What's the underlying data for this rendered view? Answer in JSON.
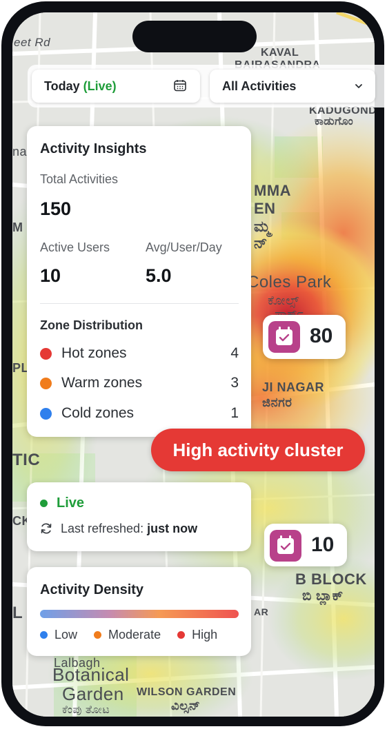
{
  "filters": {
    "date_label": "Today",
    "date_live": "(Live)",
    "activity_select": "All Activities"
  },
  "insights": {
    "title": "Activity Insights",
    "total_label": "Total Activities",
    "total_value": "150",
    "active_users_label": "Active Users",
    "active_users_value": "10",
    "avg_label": "Avg/User/Day",
    "avg_value": "5.0",
    "zone_title": "Zone Distribution",
    "zones": [
      {
        "label": "Hot zones",
        "count": "4",
        "color": "#e53935"
      },
      {
        "label": "Warm zones",
        "count": "3",
        "color": "#f07c1c"
      },
      {
        "label": "Cold zones",
        "count": "1",
        "color": "#2f80ed"
      }
    ]
  },
  "markers": [
    {
      "count": "80",
      "icon": "calendar-check-icon"
    },
    {
      "count": "10",
      "icon": "calendar-check-icon"
    }
  ],
  "cluster_label": "High activity cluster",
  "status": {
    "live": "Live",
    "refreshed_prefix": "Last refreshed:",
    "refreshed_value": "just now"
  },
  "density": {
    "title": "Activity Density",
    "legend": [
      {
        "label": "Low",
        "color": "#2f80ed"
      },
      {
        "label": "Moderate",
        "color": "#f07c1c"
      },
      {
        "label": "High",
        "color": "#e53935"
      }
    ]
  },
  "map_labels": {
    "street_top": "eet Rd",
    "kaval": "KAVAL",
    "bairasandra": "BAIRASANDRA",
    "kadugondana": "KADUGONDA",
    "kadugondana_kn": "ಕಾಡುಗೊಂ",
    "amma": "MMA",
    "en": "EN",
    "kn_amma": "ಮ್ಮ",
    "kn_en": "ನ್",
    "coles_park": "Coles Park",
    "coles_park_kn": "ಕೋಲ್ಸ್",
    "coles_park_kn2": "ಪಾರ್ಕ್",
    "ji_nagar": "JI NAGAR",
    "ji_nagar_kn": "ಜಿನಗರ",
    "tic": "TIC",
    "b_block": "B BLOCK",
    "b_block_kn": "ಬಿ ಬ್ಲಾಕ್",
    "botanical": "Botanical",
    "garden": "Garden",
    "wilson": "WILSON GARDEN",
    "wilson_kn": "ವಿಲ್ಸನ್",
    "lalbagh": "Lalbagh",
    "lalbagh_kn": "ಕೆಂಪು ತೋಟ",
    "left_na": "na",
    "left_m": "M",
    "left_pl": "PL",
    "left_ck": "CK",
    "left_l": "L",
    "left_ar": "AR"
  }
}
